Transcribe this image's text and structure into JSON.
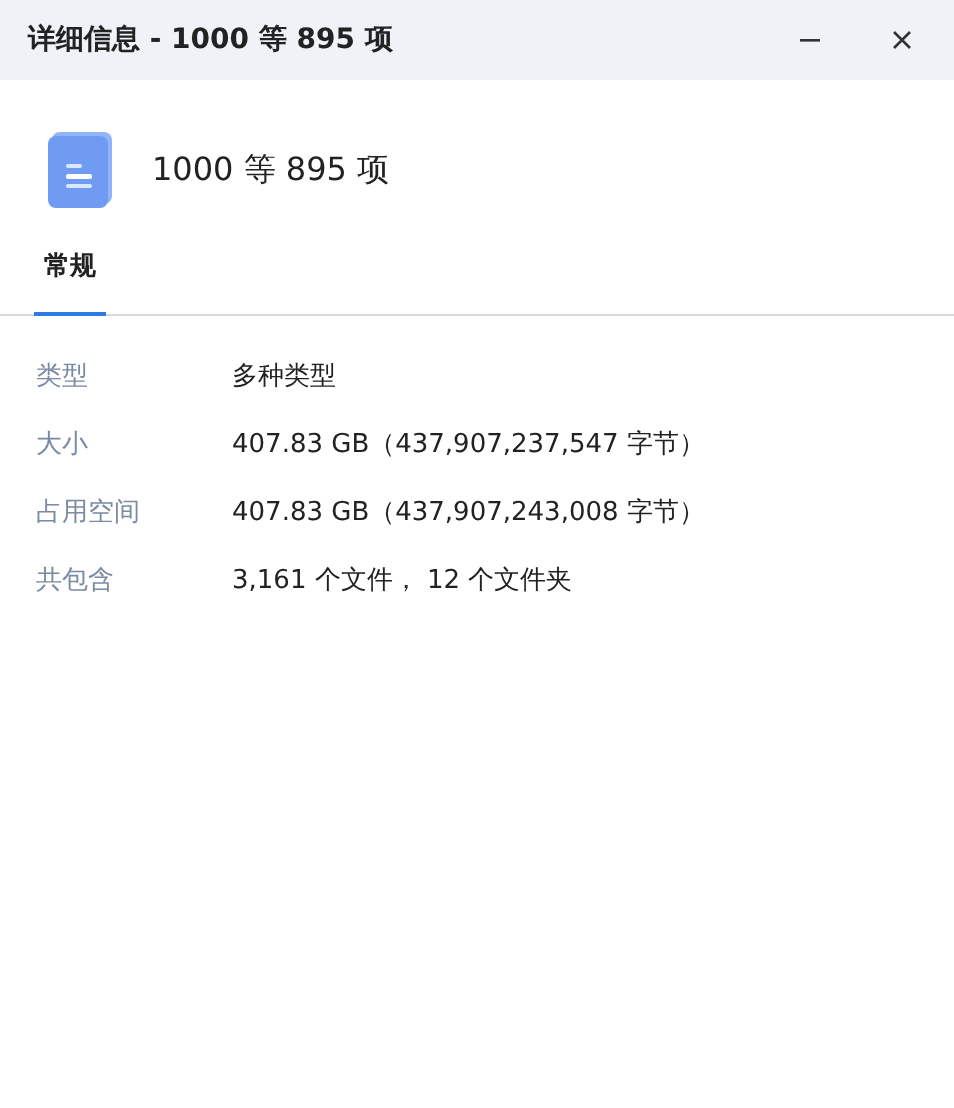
{
  "window": {
    "title": "详细信息 - 1000 等 895 项"
  },
  "header": {
    "name": "1000 等 895 项"
  },
  "tabs": [
    {
      "label": "常规",
      "selected": true
    }
  ],
  "properties": [
    {
      "label": "类型",
      "value": "多种类型"
    },
    {
      "label": "大小",
      "value": "407.83 GB（437,907,237,547 字节）"
    },
    {
      "label": "占用空间",
      "value": "407.83 GB（437,907,243,008 字节）"
    },
    {
      "label": "共包含",
      "value": "3,161 个文件， 12 个文件夹"
    }
  ]
}
